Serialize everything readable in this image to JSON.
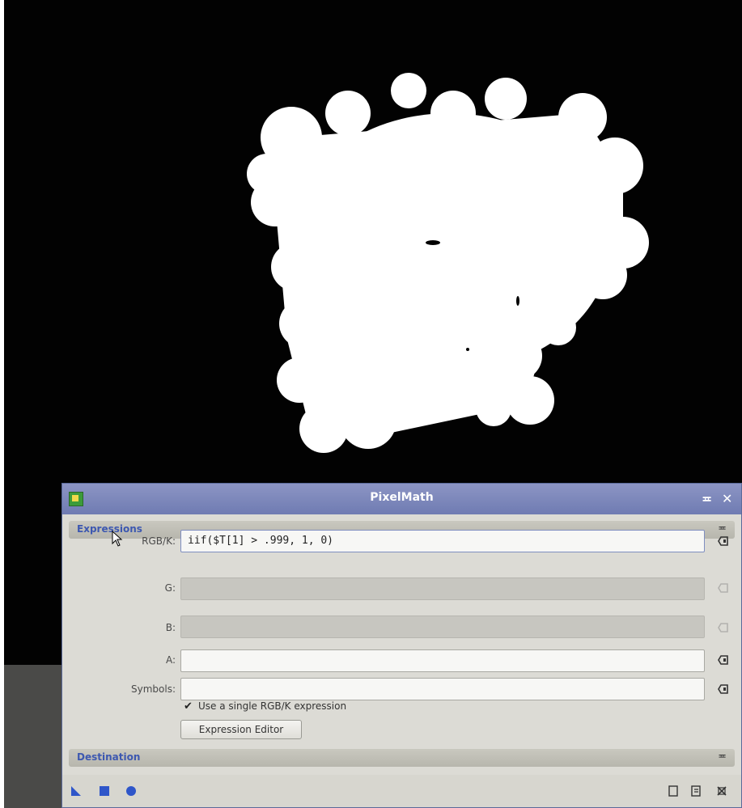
{
  "dialog": {
    "title": "PixelMath",
    "pin_symbol": "≖",
    "close_symbol": "✕",
    "icon": "pixelmath-app-icon"
  },
  "sections": {
    "expressions": {
      "title": "Expressions",
      "collapse_icon": "collapse-icon"
    },
    "destination": {
      "title": "Destination",
      "collapse_icon": "collapse-icon"
    }
  },
  "fields": {
    "rgbk": {
      "label": "RGB/K:",
      "value": "iif($T[1] > .999, 1, 0)"
    },
    "g": {
      "label": "G:",
      "value": ""
    },
    "b": {
      "label": "B:",
      "value": ""
    },
    "a": {
      "label": "A:",
      "value": ""
    },
    "symbols": {
      "label": "Symbols:",
      "value": ""
    }
  },
  "options": {
    "single_expression": {
      "label": "Use a single RGB/K expression",
      "checked": true,
      "mark": "✔"
    }
  },
  "buttons": {
    "expression_editor": "Expression Editor"
  },
  "bottom_bar": {
    "left_icons": [
      "new-instance-icon",
      "apply-icon",
      "apply-global-icon"
    ],
    "right_icons": [
      "preview-icon",
      "browse-documentation-icon",
      "reset-icon"
    ]
  },
  "colors": {
    "titlebar": "#7580b8",
    "section_title": "#3d58b0",
    "accent_blue": "#3a55c8",
    "mask": "#ffffff",
    "background": "#020202"
  }
}
